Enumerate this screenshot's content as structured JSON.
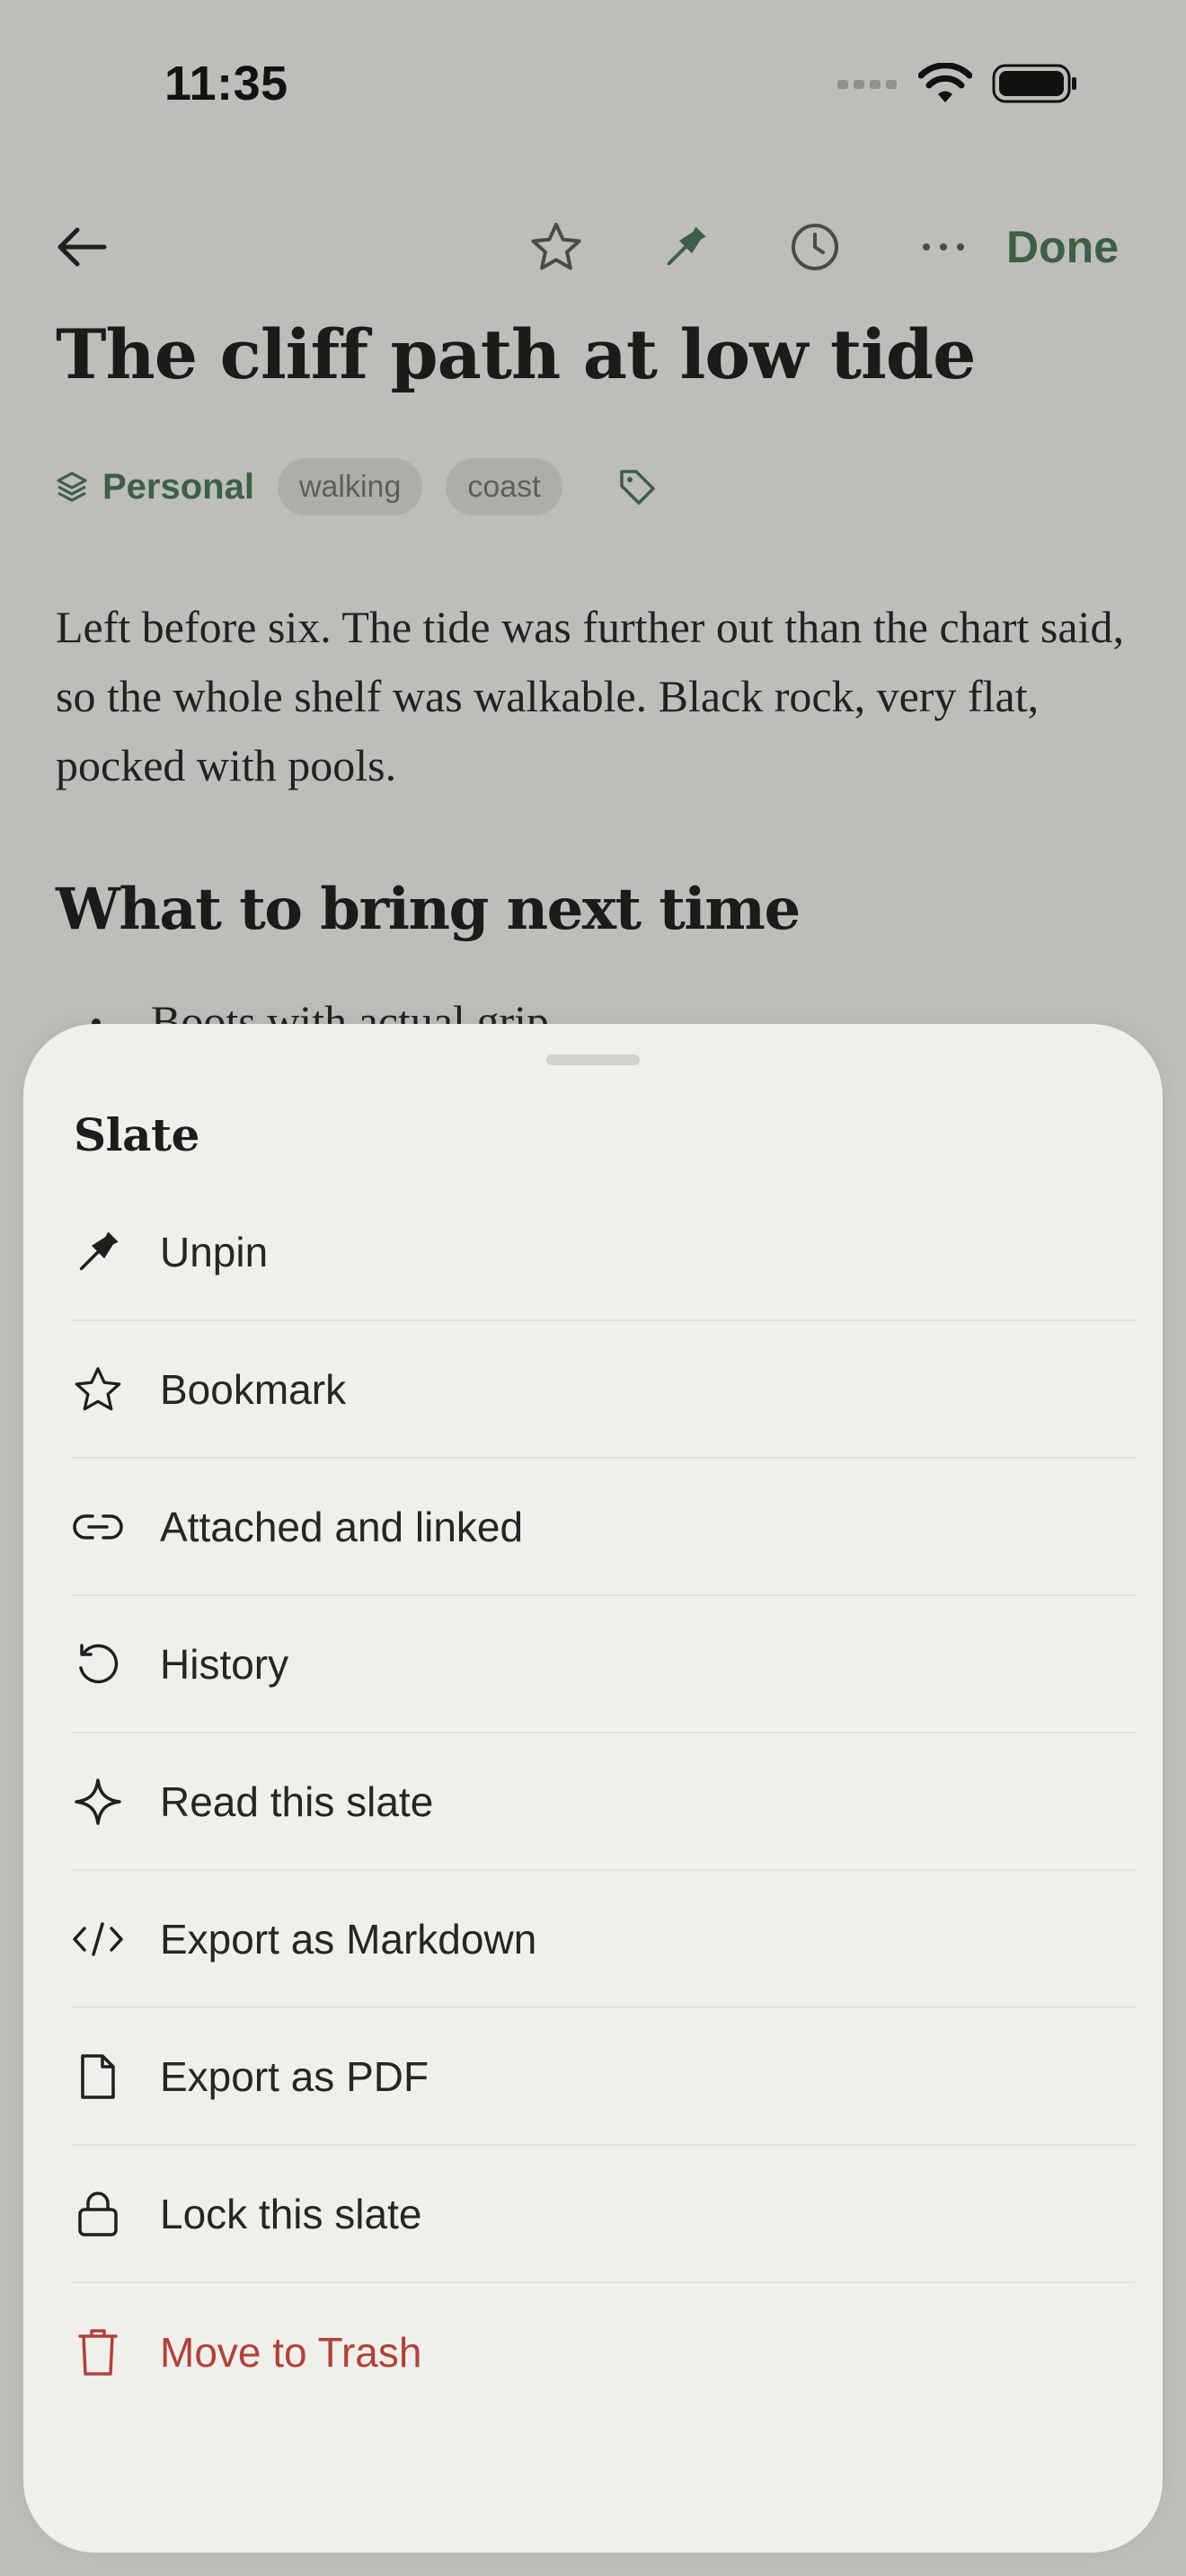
{
  "status_bar": {
    "time": "11:35"
  },
  "toolbar": {
    "done_label": "Done"
  },
  "note": {
    "title": "The cliff path at low tide",
    "notebook": "Personal",
    "tags": [
      "walking",
      "coast"
    ],
    "paragraph": "Left before six. The tide was further out than the chart said, so the whole shelf was walkable. Black rock, very flat, pocked with pools.",
    "heading": "What to bring next time",
    "bullet": "Boots with actual grip"
  },
  "sheet": {
    "title": "Slate",
    "items": [
      {
        "label": "Unpin",
        "icon": "pin-icon"
      },
      {
        "label": "Bookmark",
        "icon": "star-icon"
      },
      {
        "label": "Attached and linked",
        "icon": "link-icon"
      },
      {
        "label": "History",
        "icon": "history-icon"
      },
      {
        "label": "Read this slate",
        "icon": "sparkle-icon"
      },
      {
        "label": "Export as Markdown",
        "icon": "code-icon"
      },
      {
        "label": "Export as PDF",
        "icon": "document-icon"
      },
      {
        "label": "Lock this slate",
        "icon": "lock-icon"
      },
      {
        "label": "Move to Trash",
        "icon": "trash-icon",
        "destructive": true
      }
    ]
  },
  "colors": {
    "accent_green": "#3d5f48",
    "destructive_red": "#b0423a",
    "sheet_background": "#f0efeb",
    "dimmed_background": "#bdbdb9"
  }
}
